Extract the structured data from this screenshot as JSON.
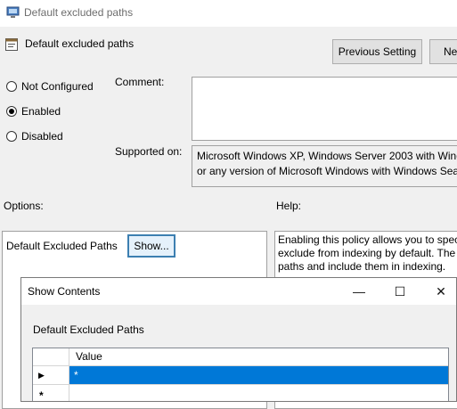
{
  "window": {
    "title": "Default excluded paths"
  },
  "header": {
    "title": "Default excluded paths",
    "prev_button": "Previous Setting",
    "next_button": "Ne"
  },
  "state": {
    "not_configured": "Not Configured",
    "enabled": "Enabled",
    "disabled": "Disabled",
    "selected": "Enabled"
  },
  "comment": {
    "label": "Comment:",
    "value": ""
  },
  "supported": {
    "label": "Supported on:",
    "line1": "Microsoft Windows XP, Windows Server 2003 with Wind",
    "line2": "or any version of Microsoft Windows with Windows Sea"
  },
  "options": {
    "label": "Options:",
    "field_label": "Default Excluded Paths",
    "show_button": "Show..."
  },
  "help": {
    "label": "Help:",
    "line1": "Enabling this policy allows you to spec",
    "line2": "exclude from indexing by default. The",
    "line3": "paths and include them in indexing."
  },
  "dialog": {
    "title": "Show Contents",
    "controls": {
      "minimize": "—",
      "maximize": "☐",
      "close": "✕"
    },
    "list_label": "Default Excluded Paths",
    "column_header": "Value",
    "rows": [
      {
        "indicator": "▶",
        "value": "*",
        "selected": true
      },
      {
        "indicator": "*",
        "value": "",
        "selected": false
      }
    ]
  },
  "colors": {
    "selection": "#0078d7",
    "focus_border": "#3c7fb1"
  }
}
